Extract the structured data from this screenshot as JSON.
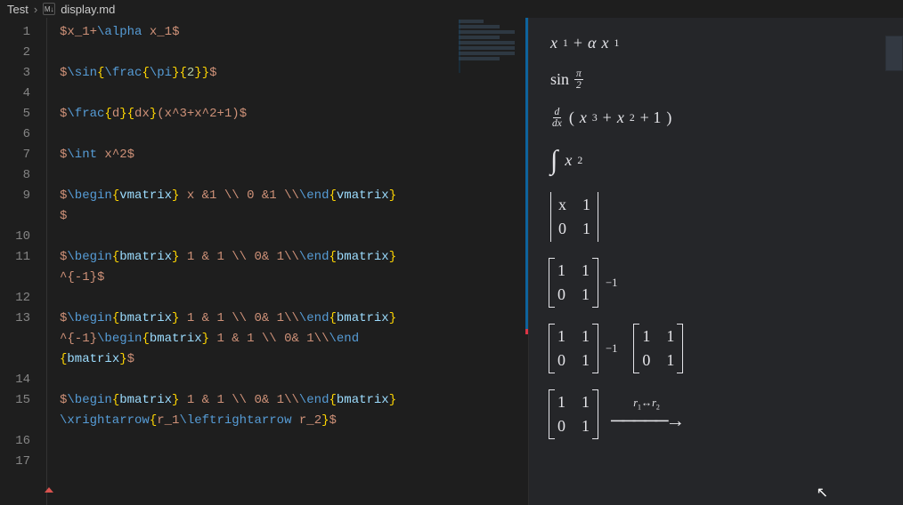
{
  "breadcrumb": {
    "folder": "Test",
    "filename": "display.md",
    "icon_label": "M↓"
  },
  "editor": {
    "lines": [
      {
        "n": 1,
        "tokens": [
          "$",
          "x",
          "_1+",
          "\\alpha",
          " x",
          "_1",
          "$"
        ],
        "styles": [
          "plain",
          "plain",
          "plain",
          "cmd",
          "plain",
          "plain",
          "plain"
        ]
      },
      {
        "n": 2,
        "tokens": [
          ""
        ],
        "styles": [
          "plain"
        ]
      },
      {
        "n": 3,
        "tokens": [
          "$",
          "\\sin",
          "{",
          "\\frac",
          "{",
          "\\pi",
          "}",
          "{",
          "2",
          "}",
          "}",
          "$"
        ],
        "styles": [
          "plain",
          "cmd",
          "brace",
          "cmd",
          "brace",
          "cmd",
          "brace",
          "brace",
          "num",
          "brace",
          "brace",
          "plain"
        ]
      },
      {
        "n": 4,
        "tokens": [
          ""
        ],
        "styles": [
          "plain"
        ]
      },
      {
        "n": 5,
        "tokens": [
          "$",
          "\\frac",
          "{",
          "d",
          "}",
          "{",
          "dx",
          "}",
          "(x^3+x^2+1)",
          "$"
        ],
        "styles": [
          "plain",
          "cmd",
          "brace",
          "plain",
          "brace",
          "brace",
          "plain",
          "brace",
          "plain",
          "plain"
        ]
      },
      {
        "n": 6,
        "tokens": [
          ""
        ],
        "styles": [
          "plain"
        ]
      },
      {
        "n": 7,
        "tokens": [
          "$",
          "\\int",
          " x^2",
          "$"
        ],
        "styles": [
          "plain",
          "cmd",
          "plain",
          "plain"
        ]
      },
      {
        "n": 8,
        "tokens": [
          ""
        ],
        "styles": [
          "plain"
        ]
      },
      {
        "n": 9,
        "tokens": [
          "$",
          "\\begin",
          "{",
          "vmatrix",
          "}",
          " x &1 \\\\ 0 &1 \\\\",
          "\\end",
          "{",
          "vmatrix",
          "}"
        ],
        "styles": [
          "plain",
          "cmd",
          "brace",
          "env",
          "brace",
          "plain",
          "cmd",
          "brace",
          "env",
          "brace"
        ]
      },
      {
        "n": 0,
        "tokens": [
          "$"
        ],
        "styles": [
          "plain"
        ],
        "continuation": true
      },
      {
        "n": 10,
        "tokens": [
          ""
        ],
        "styles": [
          "plain"
        ]
      },
      {
        "n": 11,
        "tokens": [
          "$",
          "\\begin",
          "{",
          "bmatrix",
          "}",
          " 1 & 1 \\\\ 0& 1\\\\",
          "\\end",
          "{",
          "bmatrix",
          "}"
        ],
        "styles": [
          "plain",
          "cmd",
          "brace",
          "env",
          "brace",
          "plain",
          "cmd",
          "brace",
          "env",
          "brace"
        ]
      },
      {
        "n": 0,
        "tokens": [
          "^{-1}",
          "$"
        ],
        "styles": [
          "plain",
          "plain"
        ],
        "continuation": true
      },
      {
        "n": 12,
        "tokens": [
          ""
        ],
        "styles": [
          "plain"
        ]
      },
      {
        "n": 13,
        "tokens": [
          "$",
          "\\begin",
          "{",
          "bmatrix",
          "}",
          " 1 & 1 \\\\ 0& 1\\\\",
          "\\end",
          "{",
          "bmatrix",
          "}"
        ],
        "styles": [
          "plain",
          "cmd",
          "brace",
          "env",
          "brace",
          "plain",
          "cmd",
          "brace",
          "env",
          "brace"
        ]
      },
      {
        "n": 0,
        "tokens": [
          "^{-1}",
          "\\begin",
          "{",
          "bmatrix",
          "}",
          " 1 & 1 \\\\ 0& 1\\\\",
          "\\end"
        ],
        "styles": [
          "plain",
          "cmd",
          "brace",
          "env",
          "brace",
          "plain",
          "cmd"
        ],
        "continuation": true
      },
      {
        "n": 0,
        "tokens": [
          "{",
          "bmatrix",
          "}",
          "$"
        ],
        "styles": [
          "brace",
          "env",
          "brace",
          "plain"
        ],
        "continuation": true
      },
      {
        "n": 14,
        "tokens": [
          ""
        ],
        "styles": [
          "plain"
        ]
      },
      {
        "n": 15,
        "tokens": [
          "$",
          "\\begin",
          "{",
          "bmatrix",
          "}",
          " 1 & 1 \\\\ 0& 1\\\\",
          "\\end",
          "{",
          "bmatrix",
          "}"
        ],
        "styles": [
          "plain",
          "cmd",
          "brace",
          "env",
          "brace",
          "plain",
          "cmd",
          "brace",
          "env",
          "brace"
        ]
      },
      {
        "n": 0,
        "tokens": [
          "\\xrightarrow",
          "{",
          "r_1",
          "\\leftrightarrow",
          " r_2",
          "}",
          "$"
        ],
        "styles": [
          "cmd",
          "brace",
          "plain",
          "cmd",
          "plain",
          "brace",
          "plain"
        ],
        "continuation": true
      },
      {
        "n": 16,
        "tokens": [
          ""
        ],
        "styles": [
          "plain"
        ]
      },
      {
        "n": 17,
        "tokens": [
          ""
        ],
        "styles": [
          "plain"
        ]
      }
    ]
  },
  "preview": {
    "eq1": {
      "x": "x",
      "sub": "1",
      "plus": " + ",
      "alpha": "α",
      "x2": "x",
      "sub2": "1"
    },
    "eq2": {
      "sin": "sin ",
      "num": "π",
      "den": "2"
    },
    "eq3": {
      "dnum": "d",
      "dden": "dx",
      "lp": "(",
      "body": "x",
      "exp1": "3",
      "plus1": " + ",
      "body2": "x",
      "exp2": "2",
      "plus2": " + 1",
      "rp": ")"
    },
    "eq4": {
      "sym": "∫",
      "body": "x",
      "exp": "2"
    },
    "eq5": {
      "a": "x",
      "b": "1",
      "c": "0",
      "d": "1"
    },
    "eq6": {
      "a": "1",
      "b": "1",
      "c": "0",
      "d": "1",
      "exp": "−1"
    },
    "eq7": {
      "a": "1",
      "b": "1",
      "c": "0",
      "d": "1",
      "exp": "−1",
      "a2": "1",
      "b2": "1",
      "c2": "0",
      "d2": "1"
    },
    "eq8": {
      "a": "1",
      "b": "1",
      "c": "0",
      "d": "1",
      "label_r1": "r",
      "label_s1": "1",
      "label_lr": "↔",
      "label_r2": "r",
      "label_s2": "2",
      "arrow": "────────➤"
    }
  }
}
